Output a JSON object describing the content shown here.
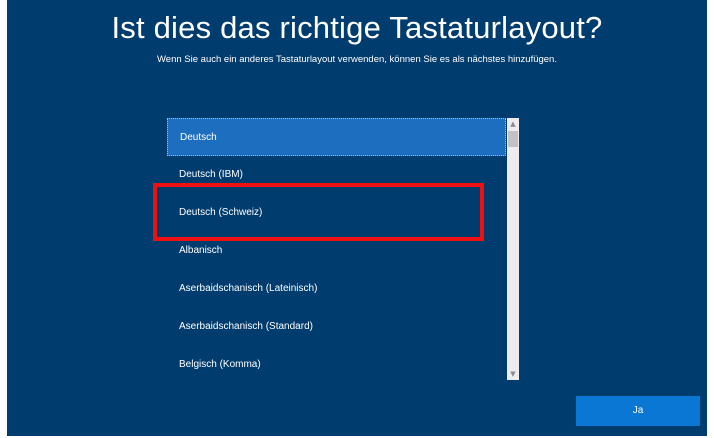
{
  "header": {
    "title": "Ist dies das richtige Tastaturlayout?",
    "subtitle": "Wenn Sie auch ein anderes Tastaturlayout verwenden, können Sie es als nächstes hinzufügen."
  },
  "layout_list": {
    "items": [
      {
        "label": "Deutsch",
        "selected": true
      },
      {
        "label": "Deutsch (IBM)",
        "selected": false
      },
      {
        "label": "Deutsch (Schweiz)",
        "selected": false
      },
      {
        "label": "Albanisch",
        "selected": false
      },
      {
        "label": "Aserbaidschanisch (Lateinisch)",
        "selected": false
      },
      {
        "label": "Aserbaidschanisch (Standard)",
        "selected": false
      },
      {
        "label": "Belgisch (Komma)",
        "selected": false
      }
    ],
    "scroll_up_icon": "chevron-up-icon",
    "scroll_down_icon": "chevron-down-icon"
  },
  "annotation": {
    "color": "#ee1111"
  },
  "footer": {
    "confirm_label": "Ja"
  },
  "colors": {
    "background": "#003c6e",
    "selected_item": "#1e6ebf",
    "button": "#0a77d5"
  }
}
